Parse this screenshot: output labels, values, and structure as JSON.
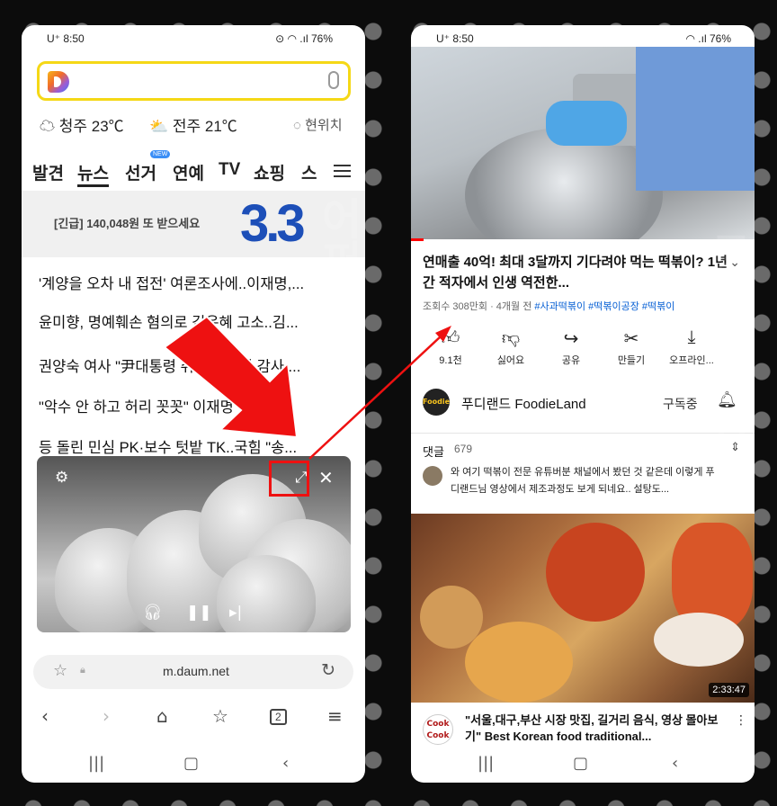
{
  "left": {
    "status": {
      "carrier": "U⁺ 8:50",
      "icons": "⊙ ◠ .ıl 76%"
    },
    "weather": {
      "city1": "청주 23℃",
      "city2": "전주 21℃",
      "location_button": "현위치"
    },
    "menu": [
      "발견",
      "뉴스",
      "선거",
      "연예",
      "TV",
      "쇼핑",
      "스"
    ],
    "menu_badge": "NEW",
    "ad": {
      "text": "[긴급] 140,048원 또 받으세요",
      "big": "3.3"
    },
    "news": [
      "'계양을 오차 내 접전' 여론조사에..이재명,...",
      "윤미향, 명예훼손 혐의로 김은혜 고소..김...",
      "권양숙 여사 \"尹대통령 취임식 초청 감사....",
      "\"악수 안 하고 허리 꼿꼿\" 이재명 만난 바...",
      "등 돌린 민심 PK·보수 텃밭 TK..국힘 \"송..."
    ],
    "url": "m.daum.net",
    "tab_count": "2"
  },
  "right": {
    "status": {
      "carrier": "U⁺ 8:50",
      "icons": "◠ .ıl 76%"
    },
    "video": {
      "title": "연매출 40억! 최대 3달까지 기다려야 먹는 떡볶이? 1년간 적자에서 인생 역전한...",
      "views": "조회수 308만회 · 4개월 전",
      "tags": "#사과떡볶이 #떡볶이공장 #떡볶이"
    },
    "actions": [
      {
        "icon": "thumbs-up-icon",
        "glyph": "👍︎",
        "label": "9.1천"
      },
      {
        "icon": "thumbs-down-icon",
        "glyph": "👎︎",
        "label": "싫어요"
      },
      {
        "icon": "share-icon",
        "glyph": "↪",
        "label": "공유"
      },
      {
        "icon": "remix-icon",
        "glyph": "✂",
        "label": "만들기"
      },
      {
        "icon": "download-icon",
        "glyph": "⤓",
        "label": "오프라인..."
      }
    ],
    "channel": {
      "name": "푸디랜드 FoodieLand",
      "subscribe": "구독중",
      "logo": "Foodie"
    },
    "comments": {
      "label": "댓글",
      "count": "679",
      "text": "와 여기 떡볶이 전문 유튜버분 채널에서 봤던 것 같은데 이렇게 푸디랜드님 영상에서 제조과정도 보게 되네요.. 설탕도..."
    },
    "next_video": {
      "duration": "2:33:47",
      "title": "\"서울,대구,부산 시장 맛집, 길거리 음식, 영상 몰아보기\" Best Korean food traditional...",
      "channel_logo": "Cook Cook"
    }
  },
  "colors": {
    "accent_red": "#ee1111",
    "daum_yellow": "#f5d816",
    "link_blue": "#065fd4"
  }
}
